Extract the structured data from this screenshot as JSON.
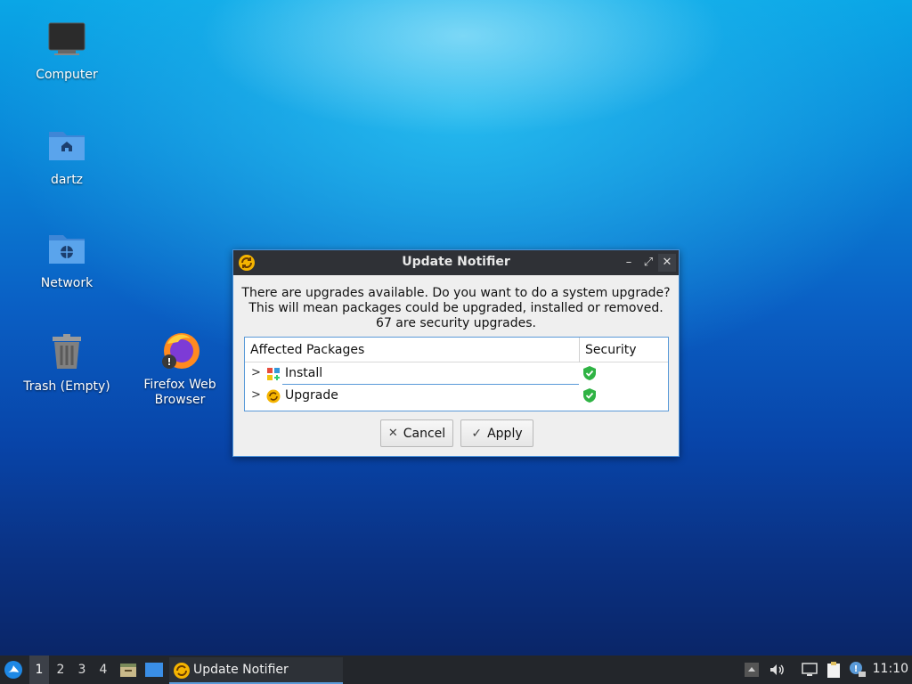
{
  "desktop": {
    "icons": [
      {
        "label": "Computer"
      },
      {
        "label": "dartz"
      },
      {
        "label": "Network"
      },
      {
        "label": "Trash (Empty)"
      },
      {
        "label": "Firefox Web Browser"
      }
    ]
  },
  "dialog": {
    "title": "Update Notifier",
    "message_line1": "There are upgrades available. Do you want to do a system upgrade?",
    "message_line2": "This will mean packages could be upgraded, installed or removed.",
    "message_line3": "67 are security upgrades.",
    "columns": [
      "Affected Packages",
      "Security"
    ],
    "rows": [
      {
        "name": "Install",
        "expander": ">"
      },
      {
        "name": "Upgrade",
        "expander": ">"
      }
    ],
    "cancel_label": "Cancel",
    "apply_label": "Apply",
    "window_controls": {
      "minimize": "–",
      "maximize": "⤢",
      "close": "✕"
    }
  },
  "panel": {
    "workspaces": [
      "1",
      "2",
      "3",
      "4"
    ],
    "active_workspace": "1",
    "task_label": "Update Notifier",
    "clock": "11:10"
  },
  "colors": {
    "accent": "#5a9ad8",
    "titlebar": "#2f3136",
    "panel": "#23262b",
    "shield_green": "#2fb344"
  }
}
